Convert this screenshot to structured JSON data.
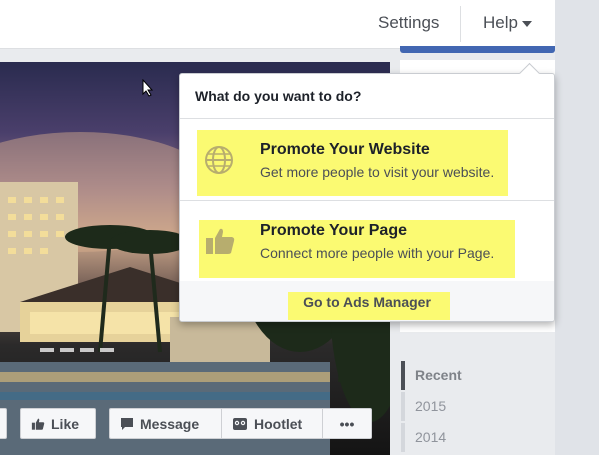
{
  "nav": {
    "settings_label": "Settings",
    "help_label": "Help"
  },
  "dropdown": {
    "header": "What do you want to do?",
    "options": [
      {
        "title": "Promote Your Website",
        "description": "Get more people to visit your website.",
        "icon": "globe-icon"
      },
      {
        "title": "Promote Your Page",
        "description": "Connect more people with your Page.",
        "icon": "thumbs-up-icon"
      }
    ],
    "footer_link": "Go to Ads Manager",
    "highlight_color": "#fbfa72"
  },
  "actions": {
    "like_label": "Like",
    "message_label": "Message",
    "hootlet_label": "Hootlet",
    "more_label": "•••"
  },
  "timeline": {
    "years": [
      "Recent",
      "2015",
      "2014"
    ],
    "active": "Recent"
  },
  "colors": {
    "brand_blue": "#4267b2",
    "background": "#e9ebee"
  }
}
